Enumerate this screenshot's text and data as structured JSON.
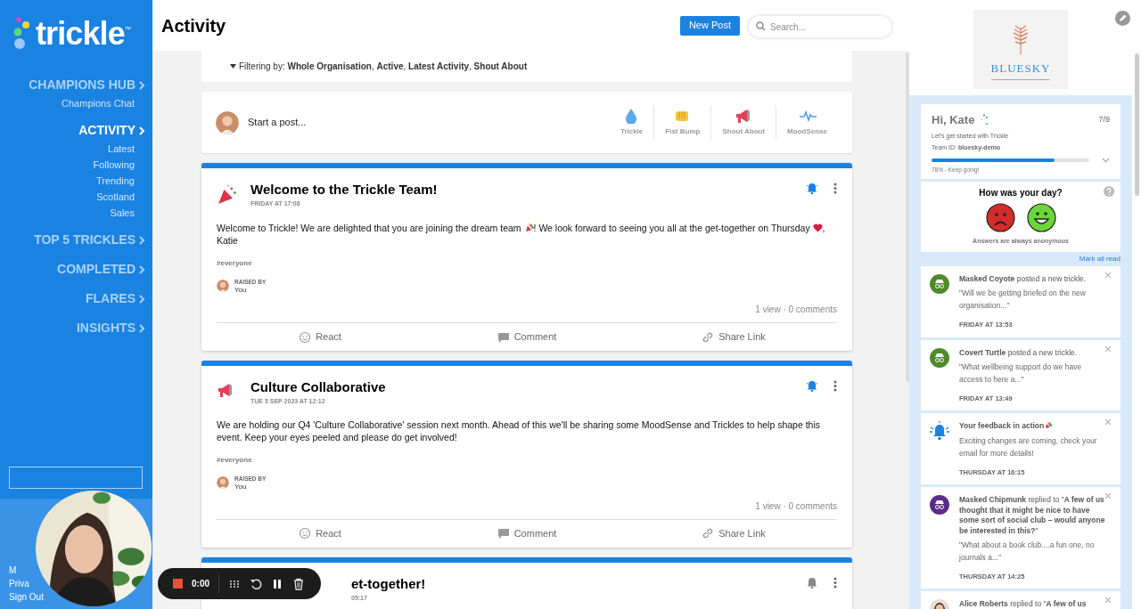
{
  "sidebar": {
    "logo": "trickle",
    "trademark": "™",
    "nav": [
      {
        "label": "CHAMPIONS HUB",
        "selected": false,
        "children": [
          "Champions Chat"
        ]
      },
      {
        "label": "ACTIVITY",
        "selected": true,
        "children": [
          "Latest",
          "Following",
          "Trending",
          "Scotland",
          "Sales"
        ]
      },
      {
        "label": "TOP 5 TRICKLES",
        "selected": false
      },
      {
        "label": "COMPLETED",
        "selected": false
      },
      {
        "label": "FLARES",
        "selected": false
      },
      {
        "label": "INSIGHTS",
        "selected": false
      }
    ],
    "footer_links": [
      "M",
      "Priva",
      "Sign Out"
    ]
  },
  "header": {
    "title": "Activity",
    "new_post": "New Post",
    "search_placeholder": "Search..."
  },
  "filter": {
    "label": "Filtering by:",
    "values": "**Whole Organisation**, **Active**, **Latest Activity**, **Shout About**"
  },
  "composer": {
    "placeholder": "Start a post...",
    "types": [
      {
        "kind": "trickle",
        "label": "Trickle"
      },
      {
        "kind": "fistbump",
        "label": "Fist Bump"
      },
      {
        "kind": "shout",
        "label": "Shout About"
      },
      {
        "kind": "mood",
        "label": "MoodSense"
      }
    ]
  },
  "posts": [
    {
      "kind": "party",
      "title": "Welcome to the Trickle Team!",
      "date": "FRIDAY AT 17:08",
      "subscribed": true,
      "body": [
        {
          "kind": "text",
          "text": "Welcome to Trickle! We are delighted that you are joining the dream team "
        },
        {
          "kind": "party"
        },
        {
          "kind": "text",
          "text": "! We look forward to seeing you all at the get-together on Thursday "
        },
        {
          "kind": "heart"
        },
        {
          "kind": "text",
          "text": ", Katie"
        }
      ],
      "tag": "#everyone",
      "raised_label": "RAISED BY",
      "raised_by": "You",
      "stats": "1 view · 0 comments",
      "actions": [
        {
          "kind": "react",
          "label": "React"
        },
        {
          "kind": "comment",
          "label": "Comment"
        },
        {
          "kind": "share",
          "label": "Share Link"
        }
      ]
    },
    {
      "kind": "shout",
      "title": "Culture Collaborative",
      "date": "TUE 5 SEP 2023 AT 12:12",
      "subscribed": true,
      "body": [
        {
          "kind": "text",
          "text": "We are holding our Q4 'Culture Collaborative' session next month. Ahead of this we'll be sharing some MoodSense and Trickles to help shape this event. Keep your eyes peeled and please do get involved!"
        }
      ],
      "tag": "#everyone",
      "raised_label": "RAISED BY",
      "raised_by": "You",
      "stats": "1 view · 0 comments",
      "actions": [
        {
          "kind": "react",
          "label": "React"
        },
        {
          "kind": "comment",
          "label": "Comment"
        },
        {
          "kind": "share",
          "label": "Share Link"
        }
      ]
    },
    {
      "kind": "none",
      "title": "et-together!",
      "date": "05:17",
      "subscribed": false
    }
  ],
  "right_panel": {
    "logo": "BLUESKY",
    "welcome": {
      "greeting": "Hi, Kate",
      "count": "7/9",
      "subtitle": "Let's get started with Trickle",
      "team_id": "Team ID: **bluesky-demo**",
      "level": 0.78,
      "progress_text": "78% - Keep going!"
    },
    "mood": {
      "question": "How was your day?",
      "options": [
        {
          "kind": "sad"
        },
        {
          "kind": "happy"
        }
      ],
      "note": "Answers are always anonymous"
    },
    "mark_all_read": "Mark all read",
    "notifications": [
      {
        "kind": "mask",
        "color": "#4e8a2a",
        "text": "**Masked Coyote** posted a new trickle.",
        "quote": "\"Will we be getting briefed on the new organisation...\"",
        "time": "FRIDAY AT 13:53"
      },
      {
        "kind": "mask",
        "color": "#4e8a2a",
        "text": "**Covert Turtle** posted a new trickle.",
        "quote": "\"What wellbeing support do we have access to here a...\"",
        "time": "FRIDAY AT 13:49"
      },
      {
        "kind": "bell",
        "text": "**Your feedback in action**",
        "quote": "Exciting changes are coming, check your email for more details!",
        "time": "THURSDAY AT 16:15"
      },
      {
        "kind": "mask",
        "color": "#5b2a8a",
        "text": "**Masked Chipmunk** replied to \"**A few of us thought that it might be nice to have some sort of social club – would anyone be interested in this?**\"",
        "quote": "\"What about a book club....a fun one, no journals a...\"",
        "time": "THURSDAY AT 14:25"
      },
      {
        "kind": "person",
        "text": "**Alice Roberts** replied to \"**A few of us**"
      }
    ]
  },
  "recorder": {
    "time": "0:00"
  }
}
